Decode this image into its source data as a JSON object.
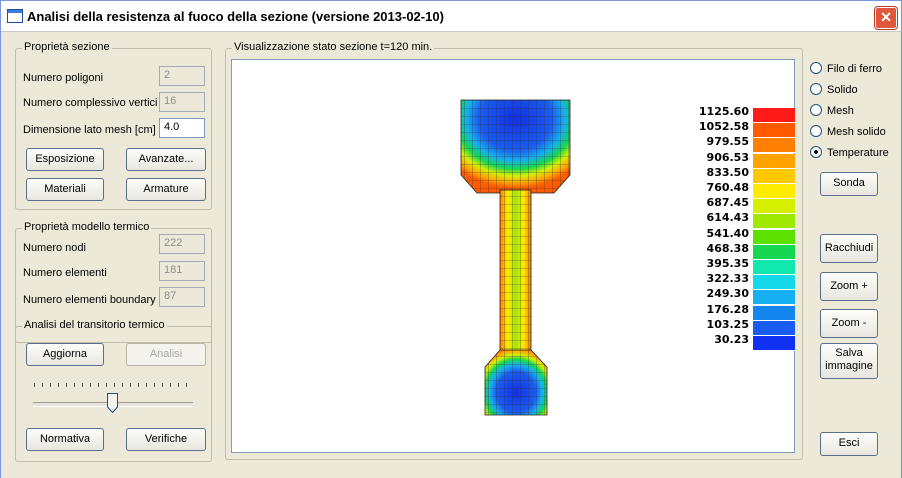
{
  "window": {
    "title": "Analisi della resistenza al fuoco della sezione (versione 2013-02-10)"
  },
  "section_props": {
    "legend": "Proprietà sezione",
    "polygons_label": "Numero poligoni",
    "polygons_value": "2",
    "vertices_label": "Numero complessivo vertici",
    "vertices_value": "16",
    "mesh_label": "Dimensione lato mesh [cm]",
    "mesh_value": "4.0",
    "exposure_btn": "Esposizione",
    "advanced_btn": "Avanzate...",
    "materials_btn": "Materiali",
    "reinforcement_btn": "Armature"
  },
  "thermal_model": {
    "legend": "Proprietà modello termico",
    "nodes_label": "Numero nodi",
    "nodes_value": "222",
    "elements_label": "Numero elementi",
    "elements_value": "181",
    "boundary_label": "Numero elementi boundary",
    "boundary_value": "87"
  },
  "transient": {
    "legend": "Analisi del transitorio termico",
    "update_btn": "Aggiorna",
    "analysis_btn": "Analisi",
    "slider_value": 0.5,
    "standard_btn": "Normativa",
    "checks_btn": "Verifiche"
  },
  "view": {
    "legend": "Visualizzazione stato sezione t=120 min."
  },
  "display_modes": {
    "options": [
      "Filo di ferro",
      "Solido",
      "Mesh",
      "Mesh solido",
      "Temperature"
    ],
    "selected": "Temperature"
  },
  "buttons": {
    "probe": "Sonda",
    "close_view": "Racchiudi",
    "zoom_in": "Zoom +",
    "zoom_out": "Zoom -",
    "save_line1": "Salva",
    "save_line2": "immagine",
    "exit": "Esci"
  },
  "temperature_scale": {
    "labels": [
      "1125.60",
      "1052.58",
      "979.55",
      "906.53",
      "833.50",
      "760.48",
      "687.45",
      "614.43",
      "541.40",
      "468.38",
      "395.35",
      "322.33",
      "249.30",
      "176.28",
      "103.25",
      "30.23"
    ],
    "colors": [
      "#ff1a1a",
      "#ff5a00",
      "#ff7f00",
      "#ffa300",
      "#ffc800",
      "#ffeb00",
      "#d4f000",
      "#a0e800",
      "#5ce000",
      "#15d850",
      "#10e8b0",
      "#15d8e8",
      "#15b0f0",
      "#1585f0",
      "#1a5cf0",
      "#1230f0"
    ]
  },
  "icons": {
    "close": "close-icon",
    "app": "app-icon"
  }
}
